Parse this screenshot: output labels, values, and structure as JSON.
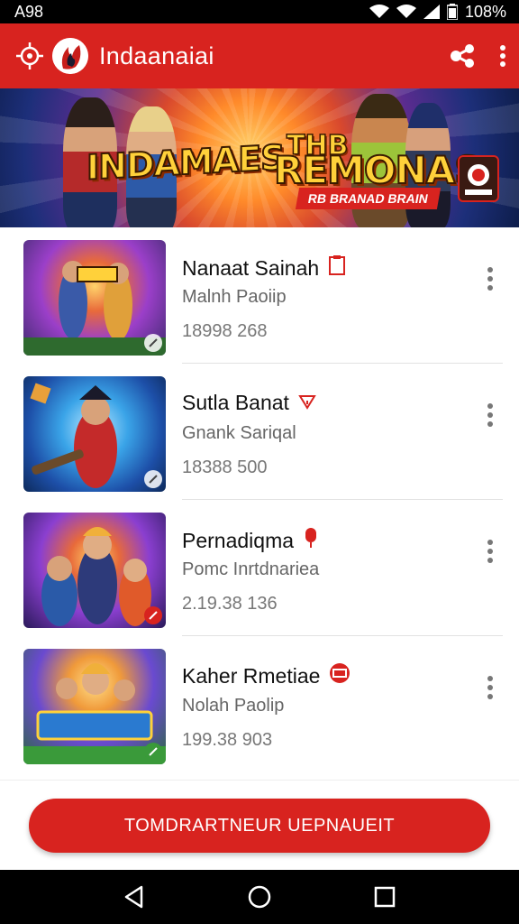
{
  "status_bar": {
    "time": "A98",
    "battery": "108%"
  },
  "app_bar": {
    "title": "Indaanaiai",
    "logo_icon": "target-icon",
    "brand_icon": "flame-logo-icon",
    "share_icon": "share-icon",
    "menu_icon": "more-vert-icon"
  },
  "banner": {
    "left_title": "INDAMAES",
    "right_top": "THB",
    "right_title": "REMONAS",
    "ribbon": "RB BRANAD BRAIN"
  },
  "games": [
    {
      "title": "Nanaat Sainah",
      "subtitle": "Malnh Paoiip",
      "meta": "18998 268",
      "tag_icon": "clipboard-icon",
      "thumb": "#b14fd1"
    },
    {
      "title": "Sutla Banat",
      "subtitle": "Gnank Sariqal",
      "meta": "18388 500",
      "tag_icon": "funnel-icon",
      "thumb": "#2aa4e8"
    },
    {
      "title": "Pernadiqma",
      "subtitle": "Pomc Inrtdnariea",
      "meta": "2.19.38 136",
      "tag_icon": "pin-icon",
      "thumb": "#8b3fd0"
    },
    {
      "title": "Kaher Rmetiae",
      "subtitle": "Nolah Paolip",
      "meta": "199.38 903",
      "tag_icon": "ticket-icon",
      "thumb": "#4a8fe0"
    }
  ],
  "cta": {
    "label": "TOMDRARTNEUR UEPNAUEIT"
  },
  "colors": {
    "primary": "#d8231f",
    "background": "#ffffff",
    "text_primary": "#111111",
    "text_secondary": "#666666"
  }
}
